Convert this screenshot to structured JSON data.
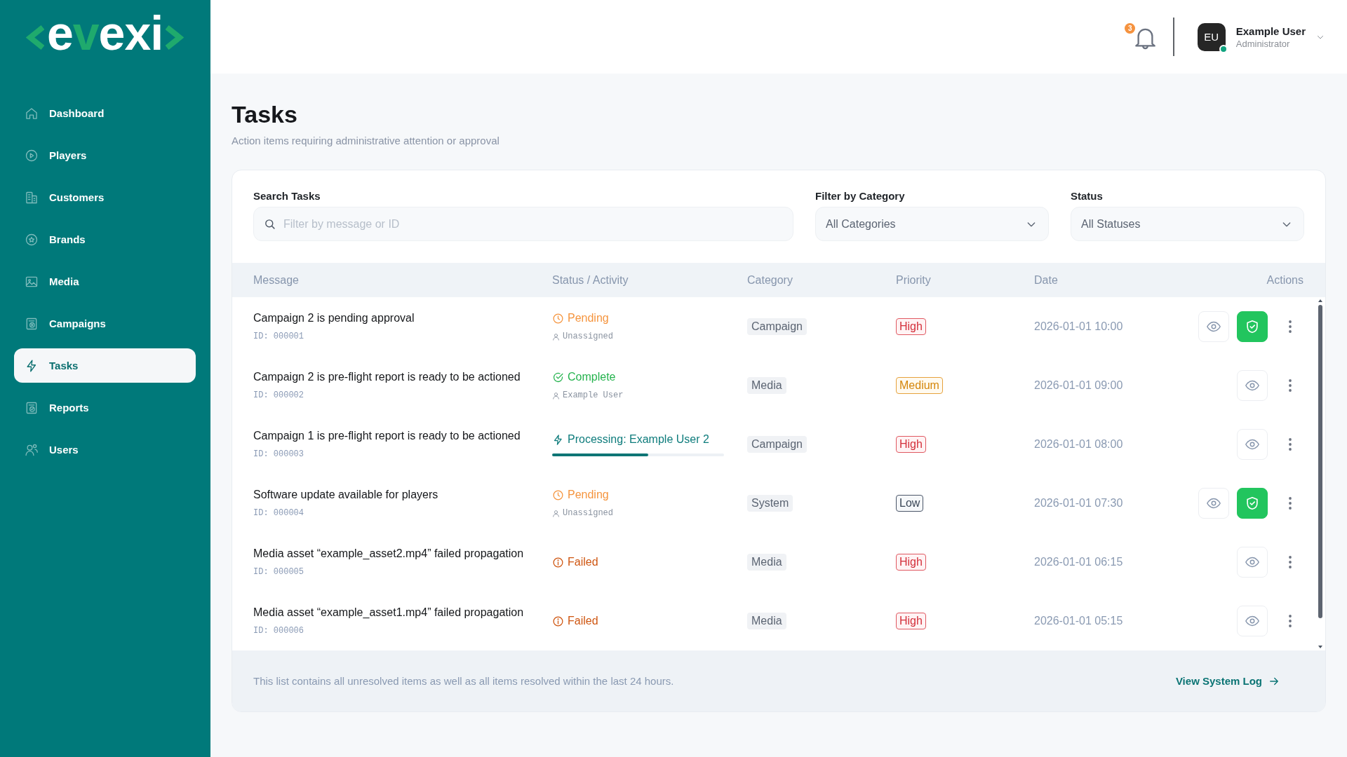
{
  "logo": {
    "parts": [
      {
        "text": "e",
        "accent": false
      },
      {
        "text": "v",
        "accent": true
      },
      {
        "text": "exi",
        "accent": false
      }
    ]
  },
  "sidebar": {
    "items": [
      {
        "label": "Dashboard",
        "selected": false
      },
      {
        "label": "Players",
        "selected": false
      },
      {
        "label": "Customers",
        "selected": false
      },
      {
        "label": "Brands",
        "selected": false
      },
      {
        "label": "Media",
        "selected": false
      },
      {
        "label": "Campaigns",
        "selected": false
      },
      {
        "label": "Tasks",
        "selected": true
      },
      {
        "label": "Reports",
        "selected": false
      },
      {
        "label": "Users",
        "selected": false
      }
    ]
  },
  "header": {
    "notifications": {
      "count": "3"
    },
    "user": {
      "initials": "EU",
      "name": "Example User",
      "role": "Administrator",
      "online": true
    }
  },
  "page": {
    "title": "Tasks",
    "subtitle": "Action items requiring administrative attention or approval"
  },
  "filters": {
    "search": {
      "label": "Search Tasks",
      "placeholder": "Filter by message or ID"
    },
    "category": {
      "label": "Filter by Category",
      "value": "All Categories"
    },
    "status": {
      "label": "Status",
      "value": "All Statuses"
    }
  },
  "table": {
    "columns": [
      "Message",
      "Status / Activity",
      "Category",
      "Priority",
      "Date",
      "Actions"
    ],
    "rows": [
      {
        "message": "Campaign 2 is pending approval",
        "id": "ID: 000001",
        "status": {
          "kind": "pending",
          "label": "Pending"
        },
        "assignee": "Unassigned",
        "category": "Campaign",
        "priority": {
          "kind": "high",
          "label": "High"
        },
        "date": "2026-01-01 10:00",
        "approve": true
      },
      {
        "message": "Campaign 2 is pre-flight report is ready to be actioned",
        "id": "ID: 000002",
        "status": {
          "kind": "complete",
          "label": "Complete"
        },
        "assignee": "Example User",
        "category": "Media",
        "priority": {
          "kind": "medium",
          "label": "Medium"
        },
        "date": "2026-01-01 09:00",
        "approve": false
      },
      {
        "message": "Campaign 1 is pre-flight report is ready to be actioned",
        "id": "ID: 000003",
        "status": {
          "kind": "processing",
          "label": "Processing: Example User 2",
          "level": 0.56
        },
        "category": "Campaign",
        "priority": {
          "kind": "high",
          "label": "High"
        },
        "date": "2026-01-01 08:00",
        "approve": false
      },
      {
        "message": "Software update available for players",
        "id": "ID: 000004",
        "status": {
          "kind": "pending",
          "label": "Pending"
        },
        "assignee": "Unassigned",
        "category": "System",
        "priority": {
          "kind": "low",
          "label": "Low"
        },
        "date": "2026-01-01 07:30",
        "approve": true
      },
      {
        "message": "Media asset “example_asset2.mp4” failed propagation",
        "id": "ID: 000005",
        "status": {
          "kind": "failed",
          "label": "Failed"
        },
        "category": "Media",
        "priority": {
          "kind": "high",
          "label": "High"
        },
        "date": "2026-01-01 06:15",
        "approve": false
      },
      {
        "message": "Media asset “example_asset1.mp4” failed propagation",
        "id": "ID: 000006",
        "status": {
          "kind": "failed",
          "label": "Failed"
        },
        "category": "Media",
        "priority": {
          "kind": "high",
          "label": "High"
        },
        "date": "2026-01-01 05:15",
        "approve": false
      }
    ]
  },
  "footer": {
    "note": "This list contains all unresolved items as well as all items resolved within the last 24 hours.",
    "link": "View System Log"
  }
}
